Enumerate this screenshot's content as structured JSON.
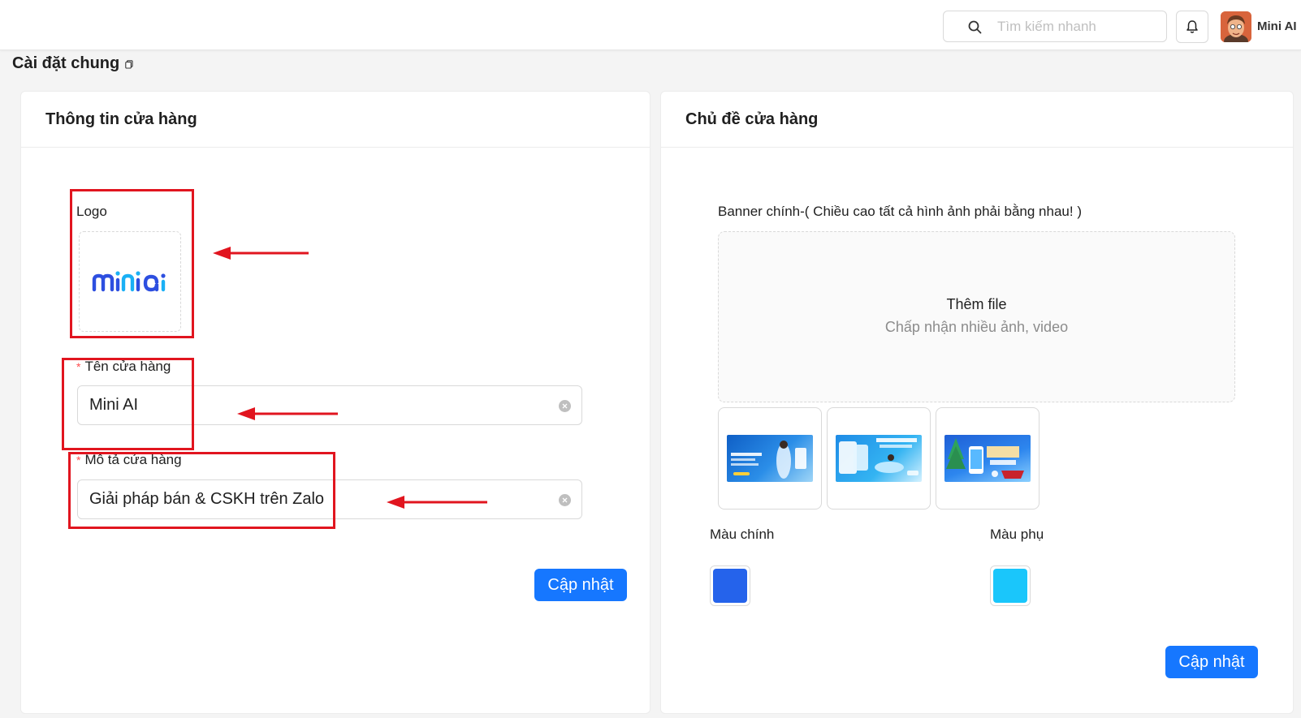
{
  "topbar": {
    "search_placeholder": "Tìm kiếm nhanh",
    "username": "Mini AI"
  },
  "page": {
    "title": "Cài đặt chung"
  },
  "store_info": {
    "title": "Thông tin cửa hàng",
    "logo_label": "Logo",
    "name_label": "Tên cửa hàng",
    "name_value": "Mini AI",
    "desc_label": "Mô tả cửa hàng",
    "desc_value": "Giải pháp bán & CSKH trên Zalo",
    "update_label": "Cập nhật"
  },
  "store_theme": {
    "title": "Chủ đề cửa hàng",
    "banner_label": "Banner chính-( Chiều cao tất cả hình ảnh phải bằng nhau! )",
    "upload_title": "Thêm file",
    "upload_subtitle": "Chấp nhận nhiều ảnh, video",
    "primary_color_label": "Màu chính",
    "secondary_color_label": "Màu phụ",
    "primary_color": "#2563eb",
    "secondary_color": "#1ac6fb",
    "update_label": "Cập nhật",
    "banners": [
      {
        "name": "banner-zalo-mini-app"
      },
      {
        "name": "banner-affiliate"
      },
      {
        "name": "banner-christmas-sale"
      }
    ]
  },
  "colors": {
    "accent": "#1677ff",
    "annotation": "#e1151f"
  }
}
